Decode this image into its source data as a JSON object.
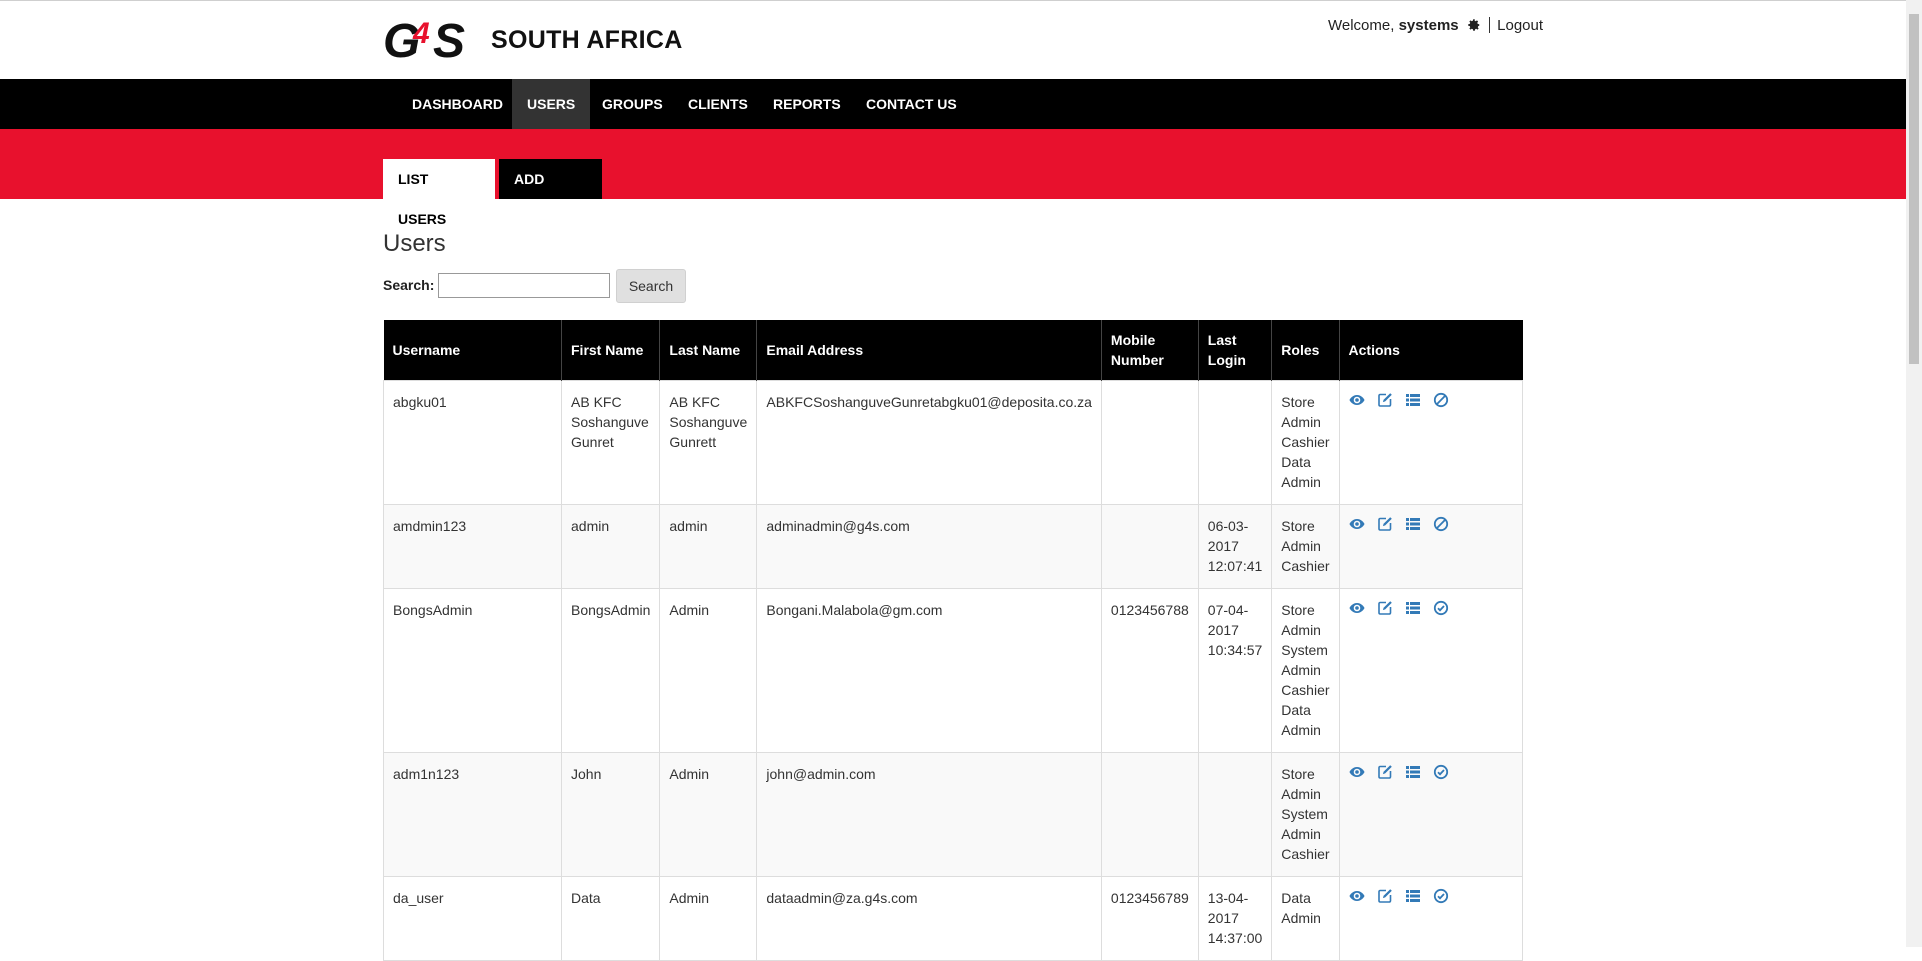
{
  "brand": {
    "logo_text": "G4S",
    "name": "SOUTH AFRICA"
  },
  "user_menu": {
    "welcome": "Welcome,",
    "username": "systems",
    "logout": "Logout"
  },
  "nav": [
    {
      "label": "DASHBOARD"
    },
    {
      "label": "USERS",
      "active": true
    },
    {
      "label": "GROUPS"
    },
    {
      "label": "CLIENTS"
    },
    {
      "label": "REPORTS"
    },
    {
      "label": "CONTACT US"
    }
  ],
  "tabs": [
    {
      "label": "LIST USERS",
      "active": true
    },
    {
      "label": "ADD USER"
    }
  ],
  "page": {
    "title": "Users",
    "search_label": "Search:",
    "search_value": "",
    "search_button": "Search"
  },
  "table": {
    "headers": [
      "Username",
      "First Name",
      "Last Name",
      "Email Address",
      "Mobile Number",
      "Last Login",
      "Roles",
      "Actions"
    ],
    "rows": [
      {
        "username": "abgku01",
        "first_name": "AB KFC Soshanguve Gunret",
        "last_name": "AB KFC Soshanguve Gunrett",
        "email": "ABKFCSoshanguveGunretabgku01@deposita.co.za",
        "mobile": "",
        "last_login": "",
        "roles": [
          "Store Admin",
          "Cashier",
          "Data Admin"
        ],
        "status_action": "disable"
      },
      {
        "username": "amdmin123",
        "first_name": "admin",
        "last_name": "admin",
        "email": "adminadmin@g4s.com",
        "mobile": "",
        "last_login": "06-03-2017 12:07:41",
        "roles": [
          "Store Admin",
          "Cashier"
        ],
        "status_action": "disable"
      },
      {
        "username": "BongsAdmin",
        "first_name": "BongsAdmin",
        "last_name": "Admin",
        "email": "Bongani.Malabola@gm.com",
        "mobile": "0123456788",
        "last_login": "07-04-2017 10:34:57",
        "roles": [
          "Store Admin",
          "System Admin",
          "Cashier",
          "Data Admin"
        ],
        "status_action": "enable"
      },
      {
        "username": "adm1n123",
        "first_name": "John",
        "last_name": "Admin",
        "email": "john@admin.com",
        "mobile": "",
        "last_login": "",
        "roles": [
          "Store Admin",
          "System Admin",
          "Cashier"
        ],
        "status_action": "enable"
      },
      {
        "username": "da_user",
        "first_name": "Data",
        "last_name": "Admin",
        "email": "dataadmin@za.g4s.com",
        "mobile": "0123456789",
        "last_login": "13-04-2017 14:37:00",
        "roles": [
          "Data Admin"
        ],
        "status_action": "enable"
      }
    ]
  },
  "icons": {
    "view": "eye-icon",
    "edit": "edit-icon",
    "list": "list-icon",
    "disable": "ban-icon",
    "enable": "check-circle-icon",
    "settings": "gear-icon"
  },
  "colors": {
    "brand_red": "#e8112d",
    "nav_black": "#000000",
    "link_blue": "#337ab7"
  }
}
